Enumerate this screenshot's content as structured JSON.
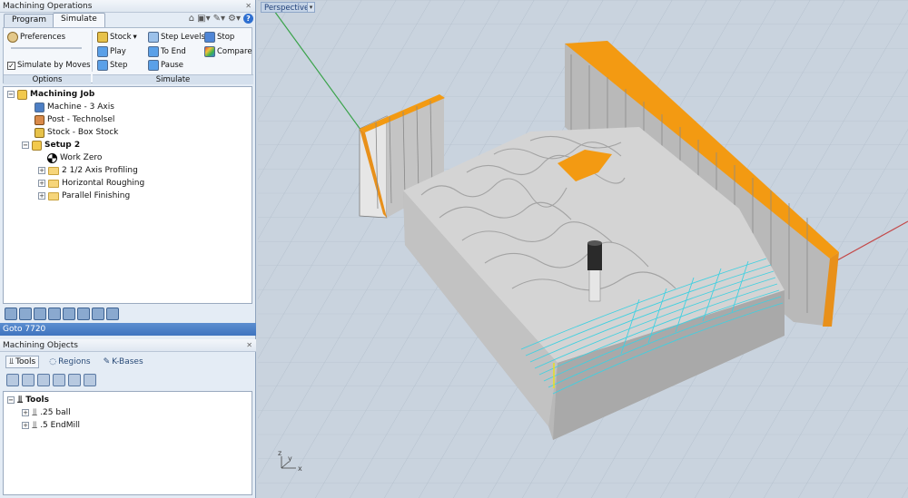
{
  "panel": {
    "title": "Machining Operations",
    "tabs": [
      "Program",
      "Simulate"
    ],
    "active_tab": "Simulate"
  },
  "ribbon": {
    "options": {
      "preferences": "Preferences",
      "simulate_by_moves": "Simulate by Moves",
      "simulate_by_moves_checked": true,
      "group_label": "Options"
    },
    "simulate": {
      "stock": "Stock",
      "play": "Play",
      "step": "Step",
      "step_levels": "Step Levels",
      "to_end": "To End",
      "pause": "Pause",
      "stop": "Stop",
      "compare": "Compare",
      "group_label": "Simulate"
    }
  },
  "job_tree": {
    "root": "Machining Job",
    "machine": "Machine - 3 Axis",
    "post": "Post - Technolsel",
    "stock": "Stock - Box Stock",
    "setup": "Setup 2",
    "work_zero": "Work Zero",
    "ops": [
      "2 1/2 Axis Profiling",
      "Horizontal Roughing",
      "Parallel Finishing"
    ]
  },
  "status": "Goto 7720",
  "objects": {
    "title": "Machining Objects",
    "tabs": [
      "Tools",
      "Regions",
      "K-Bases"
    ],
    "tree_root": "Tools",
    "tools": [
      ".25 ball",
      ".5 EndMill"
    ]
  },
  "viewport": {
    "label": "Perspective",
    "axes": {
      "x": "x",
      "y": "y",
      "z": "z"
    }
  },
  "colors": {
    "accent": "#3f74bf",
    "stock_orange": "#f39a12",
    "toolpath_cyan": "#40d0e0",
    "grid_bg": "#c9d3de"
  }
}
